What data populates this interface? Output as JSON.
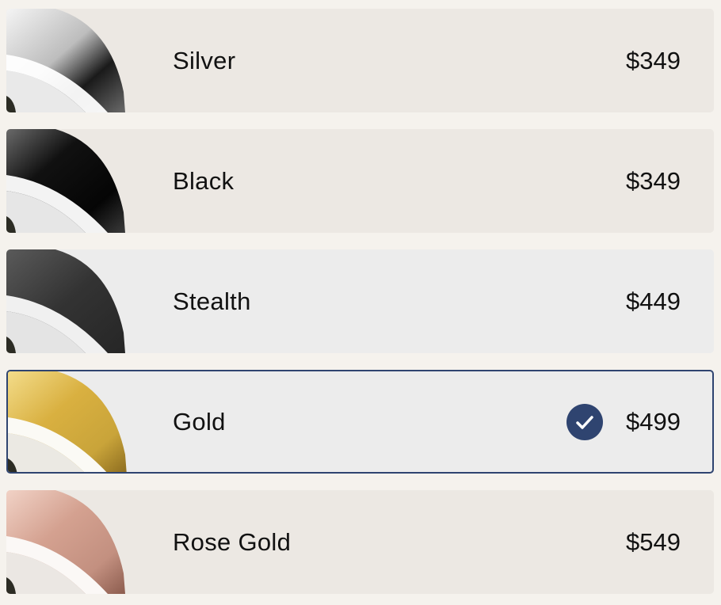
{
  "options": [
    {
      "label": "Silver",
      "price": "$349",
      "bg": "#ece8e3",
      "metal_light": "#f2f2f2",
      "metal_dark": "#8c8c8c",
      "selected": false
    },
    {
      "label": "Black",
      "price": "$349",
      "bg": "#ece8e3",
      "metal_light": "#4a4a4a",
      "metal_dark": "#0c0c0c",
      "selected": false
    },
    {
      "label": "Stealth",
      "price": "$449",
      "bg": "#ececec",
      "metal_light": "#555555",
      "metal_dark": "#262626",
      "selected": false
    },
    {
      "label": "Gold",
      "price": "$499",
      "bg": "#ececec",
      "metal_light": "#e8c95a",
      "metal_dark": "#9a7420",
      "selected": true
    },
    {
      "label": "Rose Gold",
      "price": "$549",
      "bg": "#ece8e3",
      "metal_light": "#e6b8a6",
      "metal_dark": "#a06e5e",
      "selected": false
    }
  ],
  "selected_icon": "check-circle-icon",
  "accent_color": "#2f4470"
}
